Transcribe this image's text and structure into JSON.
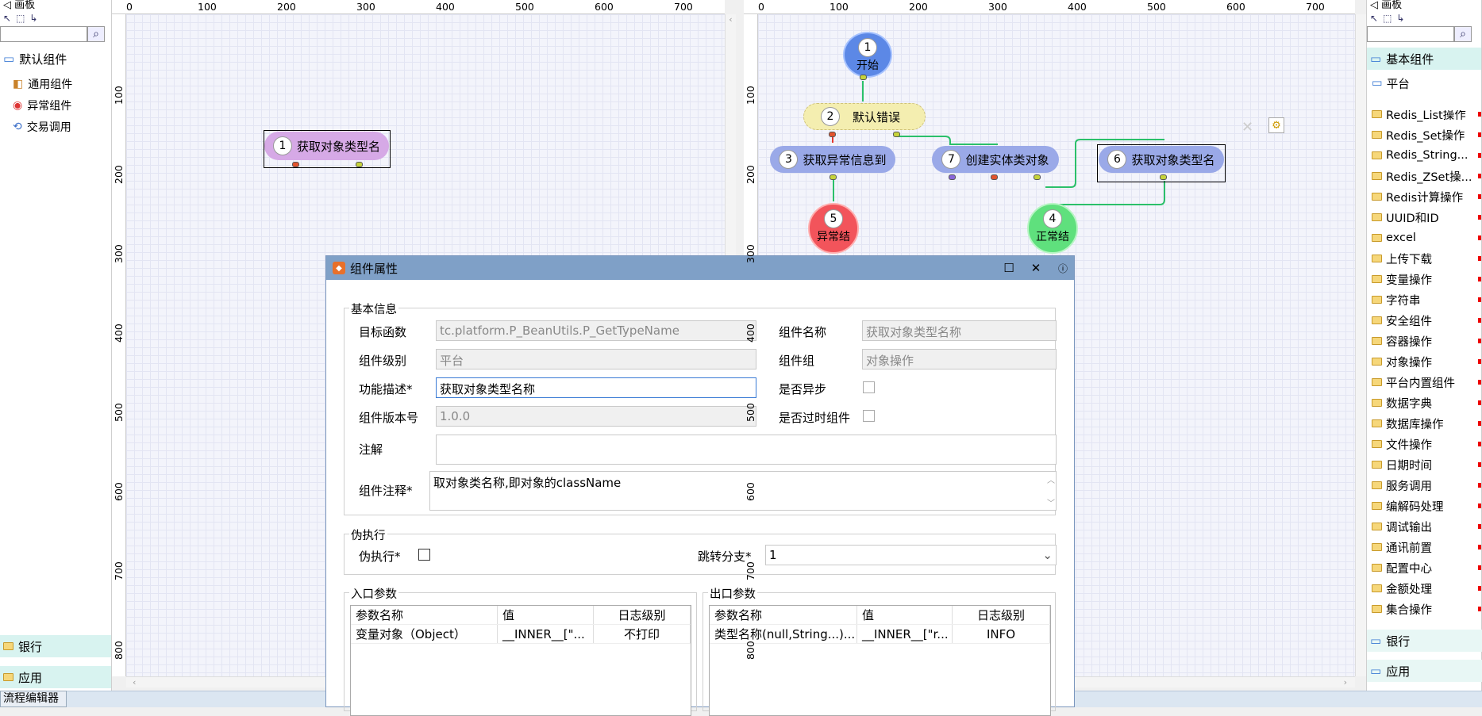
{
  "left_palette": {
    "title": "画板",
    "default_group": "默认组件",
    "items": [
      {
        "label": "通用组件",
        "icon": "general-component-icon"
      },
      {
        "label": "异常组件",
        "icon": "exception-component-icon"
      },
      {
        "label": "交易调用",
        "icon": "transaction-call-icon"
      }
    ],
    "drawers": [
      "银行",
      "应用"
    ]
  },
  "bottom_tab": "流程编辑器",
  "ruler_ticks_h": [
    "0",
    "100",
    "200",
    "300",
    "400",
    "500",
    "600",
    "700"
  ],
  "ruler_ticks_v": [
    "100",
    "200",
    "300",
    "400",
    "500",
    "600",
    "700",
    "800"
  ],
  "left_canvas": {
    "node": {
      "num": "1",
      "label": "获取对象类型名"
    }
  },
  "right_canvas": {
    "nodes": [
      {
        "num": "1",
        "label": "开始"
      },
      {
        "num": "2",
        "label": "默认错误"
      },
      {
        "num": "3",
        "label": "获取异常信息到"
      },
      {
        "num": "7",
        "label": "创建实体类对象"
      },
      {
        "num": "6",
        "label": "获取对象类型名"
      },
      {
        "num": "5",
        "label": "异常结"
      },
      {
        "num": "4",
        "label": "正常结"
      }
    ]
  },
  "right_palette": {
    "title": "画板",
    "group": "基本组件",
    "platform": "平台",
    "items": [
      "Redis_List操作",
      "Redis_Set操作",
      "Redis_String...",
      "Redis_ZSet操...",
      "Redis计算操作",
      "UUID和ID",
      "excel",
      "上传下载",
      "变量操作",
      "字符串",
      "安全组件",
      "容器操作",
      "对象操作",
      "平台内置组件",
      "数据字典",
      "数据库操作",
      "文件操作",
      "日期时间",
      "服务调用",
      "编解码处理",
      "调试输出",
      "通讯前置",
      "配置中心",
      "金额处理",
      "集合操作"
    ],
    "drawers": [
      "银行",
      "应用"
    ]
  },
  "dialog": {
    "title": "组件属性",
    "basic_group": "基本信息",
    "target_func_label": "目标函数",
    "target_func": "tc.platform.P_BeanUtils.P_GetTypeName",
    "comp_name_label": "组件名称",
    "comp_name": "获取对象类型名称",
    "level_label": "组件级别",
    "level": "平台",
    "comp_group_label": "组件组",
    "comp_group": "对象操作",
    "desc_label": "功能描述*",
    "desc": "获取对象类型名称",
    "async_label": "是否异步",
    "version_label": "组件版本号",
    "version": "1.0.0",
    "deprecated_label": "是否过时组件",
    "note_label": "注解",
    "comment_label": "组件注释*",
    "comment": "取对象类名称,即对象的className",
    "pseudo_group": "伪执行",
    "pseudo_label": "伪执行*",
    "branch_label": "跳转分支*",
    "branch": "1",
    "in_group": "入口参数",
    "out_group": "出口参数",
    "in_headers": [
      "参数名称",
      "值",
      "日志级别"
    ],
    "in_rows": [
      [
        "变量对象（Object）",
        "__INNER__[\"...",
        "不打印"
      ]
    ],
    "out_headers": [
      "参数名称",
      "值",
      "日志级别"
    ],
    "out_rows": [
      [
        "类型名称(null,String...)...",
        "__INNER__[\"r...",
        "INFO"
      ]
    ]
  }
}
